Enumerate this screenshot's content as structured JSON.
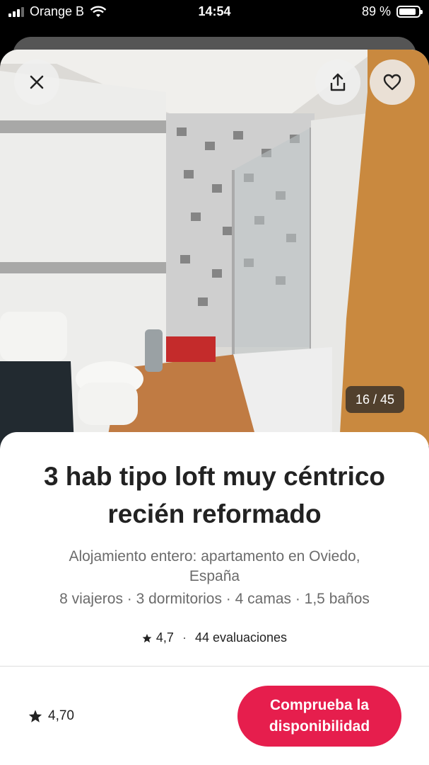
{
  "status_bar": {
    "carrier": "Orange B",
    "time": "14:54",
    "battery_percent_label": "89 %",
    "battery_level": 0.89
  },
  "gallery": {
    "counter": "16 / 45",
    "close_icon": "close-icon",
    "share_icon": "share-icon",
    "favorite_icon": "heart-icon"
  },
  "listing": {
    "title": "3 hab  tipo loft muy céntrico recién reformado",
    "subtitle": "Alojamiento entero: apartamento en Oviedo, España",
    "details": "8 viajeros · 3 dormitorios · 4 camas · 1,5 baños",
    "rating": "4,7",
    "separator": "·",
    "reviews": "44 evaluaciones"
  },
  "footer": {
    "rating": "4,70",
    "cta_label": "Comprueba la disponibilidad",
    "cta_color": "#e61e4d"
  }
}
